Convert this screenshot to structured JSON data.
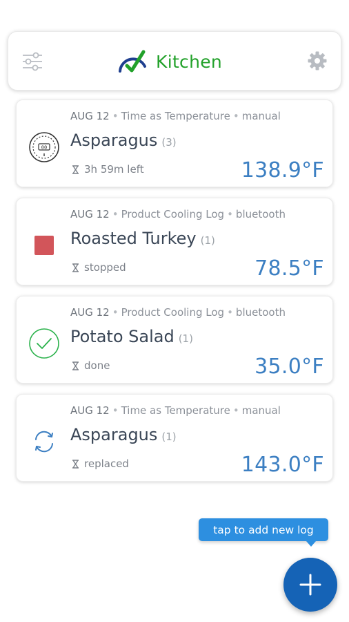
{
  "header": {
    "title": "Kitchen",
    "filter_icon": "sliders-icon",
    "settings_icon": "gear-icon",
    "brand_color": "#22a12a"
  },
  "logs": [
    {
      "date": "AUG 12",
      "log_type": "Time as Temperature",
      "source": "manual",
      "title": "Asparagus",
      "count": "(3)",
      "status": "3h 59m left",
      "temperature": "138.9°F",
      "icon": "timer-gauge-icon"
    },
    {
      "date": "AUG 12",
      "log_type": "Product Cooling Log",
      "source": "bluetooth",
      "title": "Roasted Turkey",
      "count": "(1)",
      "status": "stopped",
      "temperature": "78.5°F",
      "icon": "stop-square-icon",
      "icon_color": "#d2555a"
    },
    {
      "date": "AUG 12",
      "log_type": "Product Cooling Log",
      "source": "bluetooth",
      "title": "Potato Salad",
      "count": "(1)",
      "status": "done",
      "temperature": "35.0°F",
      "icon": "check-circle-icon",
      "icon_color": "#2bb24c"
    },
    {
      "date": "AUG 12",
      "log_type": "Time as Temperature",
      "source": "manual",
      "title": "Asparagus",
      "count": "(1)",
      "status": "replaced",
      "temperature": "143.0°F",
      "icon": "replace-arrows-icon",
      "icon_color": "#3c7fc2"
    }
  ],
  "tooltip": {
    "text": "tap to add new log"
  },
  "fab": {
    "icon": "plus-icon",
    "color": "#1563b6"
  },
  "colors": {
    "temperature": "#3c7fc2",
    "tooltip": "#2d8fe0"
  }
}
